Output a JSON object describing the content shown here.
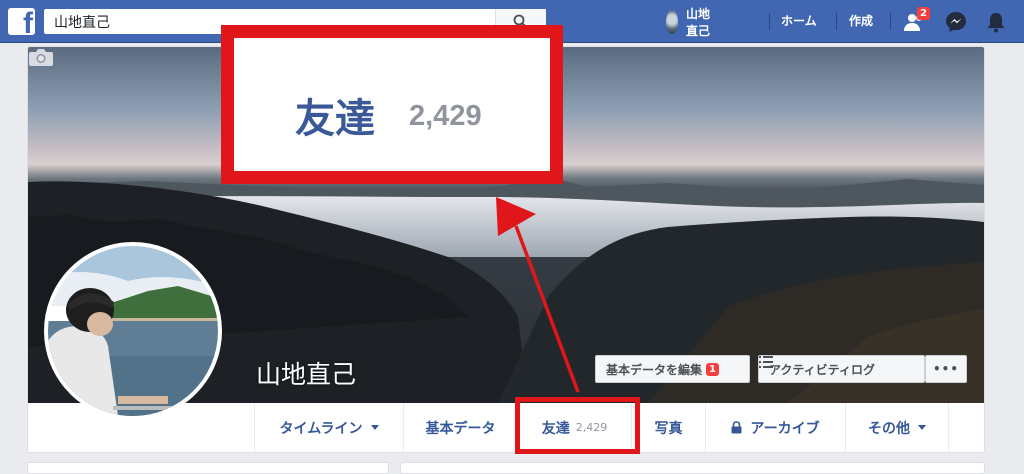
{
  "topbar": {
    "logo": "f",
    "search_value": "山地直己",
    "user_name": "山地直己",
    "home_label": "ホーム",
    "create_label": "作成",
    "friend_requests_badge": "2",
    "icons": [
      "facebook-logo-icon",
      "search-icon",
      "friends-icon",
      "messenger-icon",
      "notifications-bell-icon"
    ]
  },
  "profile": {
    "name": "山地直己",
    "edit_profile_label": "基本データを編集",
    "edit_profile_badge": "1",
    "activity_log_label": "アクティビティログ",
    "more_label": "•••",
    "tabs": [
      {
        "label": "タイムライン",
        "dropdown": true
      },
      {
        "label": "基本データ"
      },
      {
        "label": "友達",
        "count": "2,429"
      },
      {
        "label": "写真"
      },
      {
        "label": "アーカイブ",
        "icon": "lock-icon"
      },
      {
        "label": "その他",
        "dropdown": true
      }
    ]
  },
  "callout": {
    "label": "友達",
    "count": "2,429"
  },
  "colors": {
    "facebook_blue": "#4267b2",
    "link_blue": "#365899",
    "annotation_red": "#e0161b",
    "badge_red": "#fa3e3e"
  }
}
